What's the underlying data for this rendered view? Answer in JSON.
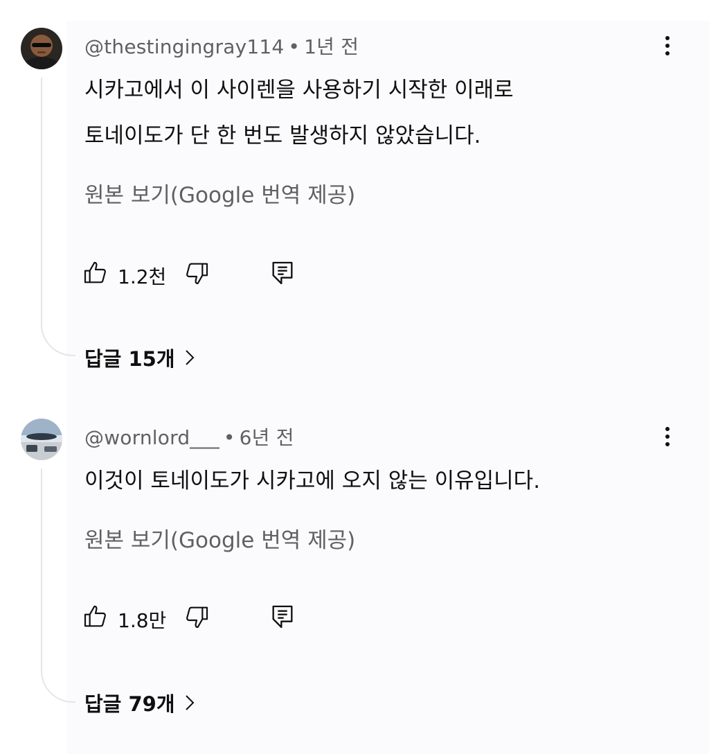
{
  "comments": [
    {
      "author": "@thestingingray114",
      "separator": "•",
      "time": "1년 전",
      "body_lines": [
        "시카고에서 이 사이렌을 사용하기 시작한 이래로",
        "토네이도가 단 한 번도 발생하지 않았습니다."
      ],
      "see_original": "원본 보기(Google 번역 제공)",
      "likes": "1.2천",
      "replies_label": "답글 15개",
      "avatar_icon": "person-sunglasses-avatar"
    },
    {
      "author": "@wornlord___",
      "separator": "•",
      "time": "6년 전",
      "body_lines": [
        "이것이 토네이도가 시카고에 오지 않는 이유입니다."
      ],
      "see_original": "원본 보기(Google 번역 제공)",
      "likes": "1.8만",
      "replies_label": "답글 79개",
      "avatar_icon": "landscape-car-avatar"
    }
  ],
  "icons": {
    "more": "three-dots-vertical-icon",
    "like": "thumbs-up-icon",
    "dislike": "thumbs-down-icon",
    "reply": "reply-comment-icon",
    "chevron": "chevron-right-icon"
  },
  "colors": {
    "text_primary": "#0f0f0f",
    "text_secondary": "#606060",
    "thread_line": "#e5e5e5",
    "panel_bg": "#fbfafc"
  }
}
